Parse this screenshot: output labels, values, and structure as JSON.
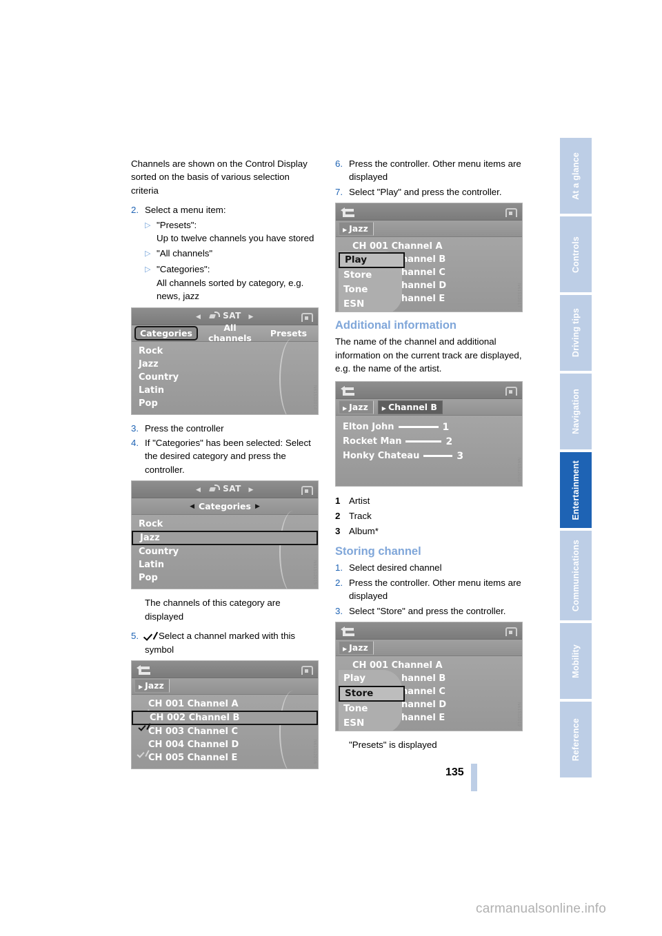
{
  "page": {
    "number": "135",
    "footer": "carmanualsonline.info"
  },
  "tabs": [
    {
      "label": "At a glance",
      "active": false
    },
    {
      "label": "Controls",
      "active": false
    },
    {
      "label": "Driving tips",
      "active": false
    },
    {
      "label": "Navigation",
      "active": false
    },
    {
      "label": "Entertainment",
      "active": true
    },
    {
      "label": "Communications",
      "active": false
    },
    {
      "label": "Mobility",
      "active": false
    },
    {
      "label": "Reference",
      "active": false
    }
  ],
  "colors": {
    "accent": "#1e63b4",
    "tab_inactive": "#bdcee6",
    "heading": "#7fa6d9"
  },
  "left": {
    "intro": "Channels are shown on the Control Display sorted on the basis of various selection criteria",
    "step2": {
      "num": "2.",
      "text": "Select a menu item:"
    },
    "bullets": [
      {
        "title": "\"Presets\":",
        "detail": "Up to twelve channels you have stored"
      },
      {
        "title": "\"All channels\"",
        "detail": ""
      },
      {
        "title": "\"Categories\":",
        "detail": "All channels sorted by category, e.g. news, jazz"
      }
    ],
    "step3": {
      "num": "3.",
      "text": "Press the controller"
    },
    "step4": {
      "num": "4.",
      "text": "If \"Categories\" has been selected: Select the desired category and press the controller."
    },
    "after4": "The channels of this category are displayed",
    "step5": {
      "num": "5.",
      "text": "Select a channel marked with this symbol"
    },
    "shot1": {
      "title": "SAT",
      "tabs": [
        "Categories",
        "All channels",
        "Presets"
      ],
      "selected_tab": "Categories",
      "items": [
        "Rock",
        "Jazz",
        "Country",
        "Latin",
        "Pop"
      ]
    },
    "shot2": {
      "title": "SAT",
      "crumb": "Categories",
      "items": [
        "Rock",
        "Jazz",
        "Country",
        "Latin",
        "Pop"
      ],
      "selected_item": "Jazz"
    },
    "shot3": {
      "crumb": "Jazz",
      "items": [
        {
          "label": "CH 001 Channel A",
          "checked": true,
          "selected": false
        },
        {
          "label": "CH 002 Channel B",
          "checked": true,
          "selected": true
        },
        {
          "label": "CH 003 Channel C",
          "checked": false,
          "selected": false
        },
        {
          "label": "CH 004 Channel D",
          "checked": true,
          "selected": false
        },
        {
          "label": "CH 005 Channel E",
          "checked": false,
          "selected": false
        }
      ]
    }
  },
  "right": {
    "step6": {
      "num": "6.",
      "text": "Press the controller. Other menu items are displayed"
    },
    "step7": {
      "num": "7.",
      "text": "Select \"Play\" and press the controller."
    },
    "shot4": {
      "crumb": "Jazz",
      "items": [
        "CH 001 Channel A",
        "hannel B",
        "hannel C",
        "hannel D",
        "hannel E"
      ],
      "popup": [
        "Play",
        "Store",
        "Tone",
        "ESN"
      ],
      "popup_selected": "Play"
    },
    "section_additional": {
      "heading": "Additional information",
      "body": "The name of the channel and additional information on the current track are displayed, e.g. the name of the artist."
    },
    "shot5": {
      "crumb1": "Jazz",
      "crumb2": "Channel B",
      "rows": [
        {
          "label": "Elton John",
          "index": "1"
        },
        {
          "label": "Rocket Man",
          "index": "2"
        },
        {
          "label": "Honky Chateau",
          "index": "3"
        }
      ]
    },
    "legend": [
      {
        "num": "1",
        "label": "Artist"
      },
      {
        "num": "2",
        "label": "Track"
      },
      {
        "num": "3",
        "label": "Album*"
      }
    ],
    "section_storing": {
      "heading": "Storing channel",
      "steps": [
        {
          "num": "1.",
          "text": "Select desired channel"
        },
        {
          "num": "2.",
          "text": "Press the controller. Other menu items are displayed"
        },
        {
          "num": "3.",
          "text": "Select \"Store\" and press the controller."
        }
      ]
    },
    "shot6": {
      "crumb": "Jazz",
      "items": [
        "CH 001 Channel A",
        "hannel B",
        "hannel C",
        "hannel D",
        "hannel E"
      ],
      "popup": [
        "Play",
        "Store",
        "Tone",
        "ESN"
      ],
      "popup_selected": "Store"
    },
    "after_shot6": "\"Presets\" is displayed"
  }
}
